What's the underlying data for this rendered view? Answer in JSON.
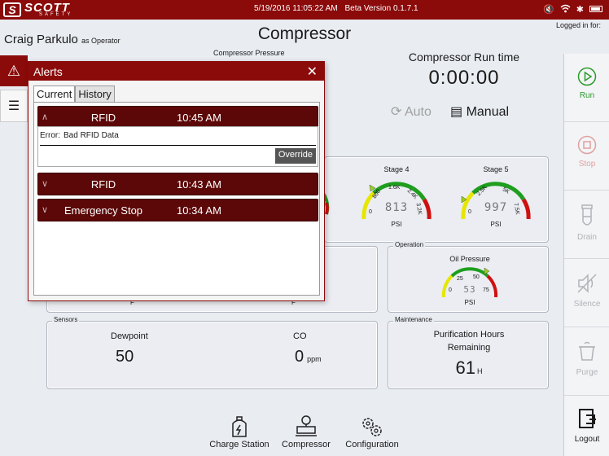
{
  "topbar": {
    "logo_text": "SCOTT",
    "logo_sub": "SAFETY",
    "datetime": "5/19/2016 11:05:22 AM",
    "version": "Beta Version 0.1.7.1"
  },
  "header": {
    "user_name": "Craig Parkulo",
    "user_role": "as Operator",
    "title": "Compressor",
    "logged_in": "Logged in for:"
  },
  "compressor": {
    "pressure_label": "Compressor Pressure",
    "runtime_label": "Compressor Run time",
    "runtime_value": "0:00:00",
    "auto_label": "Auto",
    "manual_label": "Manual"
  },
  "stages": [
    {
      "title": "Stage 4",
      "ticks": [
        "0",
        "800",
        "1.6K",
        "2.4K",
        "3.2K"
      ],
      "reading": "813",
      "unit": "PSI"
    },
    {
      "title": "Stage 5",
      "ticks": [
        "0",
        "2.5K",
        "5K",
        "7.5K"
      ],
      "reading": "997",
      "unit": "PSI"
    }
  ],
  "operation": {
    "legend": "Operation",
    "oil_title": "Oil Pressure",
    "oil_ticks": [
      "0",
      "25",
      "50",
      "75"
    ],
    "oil_reading": "53",
    "oil_unit": "PSI"
  },
  "temps": {
    "unit1": "F",
    "unit2": "F"
  },
  "sensors": {
    "legend": "Sensors",
    "dewpoint_label": "Dewpoint",
    "dewpoint_value": "50",
    "co_label": "CO",
    "co_value": "0",
    "co_unit": "ppm"
  },
  "maintenance": {
    "legend": "Maintenance",
    "title_line1": "Purification Hours",
    "title_line2": "Remaining",
    "value": "61",
    "unit": "H"
  },
  "bottom_nav": {
    "charge_station": "Charge Station",
    "compressor": "Compressor",
    "configuration": "Configuration"
  },
  "sidebar": {
    "run": "Run",
    "stop": "Stop",
    "drain": "Drain",
    "silence": "Silence",
    "purge": "Purge",
    "logout": "Logout"
  },
  "alerts": {
    "title": "Alerts",
    "tab_current": "Current",
    "tab_history": "History",
    "items": [
      {
        "name": "RFID",
        "time": "10:45 AM"
      },
      {
        "name": "RFID",
        "time": "10:43 AM"
      },
      {
        "name": "Emergency Stop",
        "time": "10:34 AM"
      }
    ],
    "detail_label": "Error:",
    "detail_text": "Bad RFID Data",
    "override_label": "Override"
  },
  "colors": {
    "brand": "#8b0a0a",
    "alert_row": "#5c0808",
    "run_green": "#2a9a2a",
    "gauge_green": "#1e9e1e",
    "gauge_yellow": "#e6e600",
    "gauge_red": "#d01010"
  }
}
